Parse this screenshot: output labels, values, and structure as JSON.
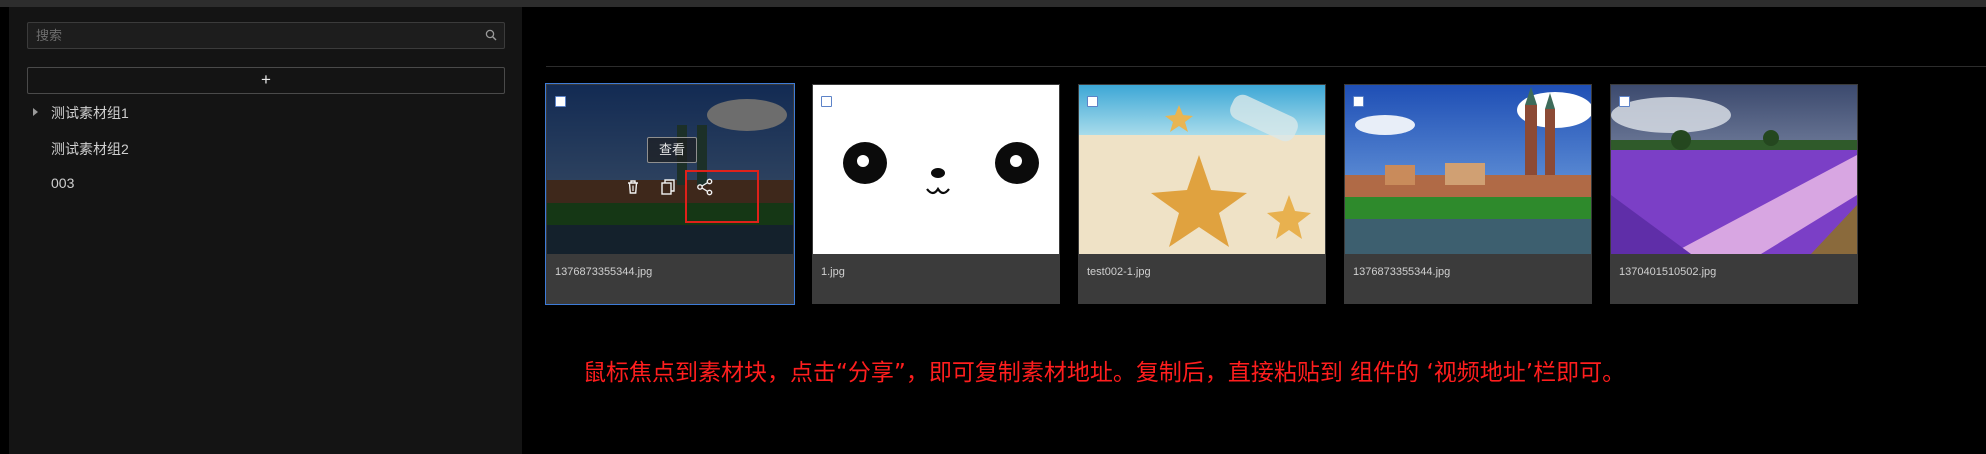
{
  "search": {
    "placeholder": "搜索",
    "icon": "search-icon"
  },
  "add_button": {
    "label": "+"
  },
  "groups": [
    {
      "label": "测试素材组1",
      "expandable": true
    },
    {
      "label": "测试素材组2"
    },
    {
      "label": "003"
    }
  ],
  "cards": [
    {
      "filename": "1376873355344.jpg",
      "checked": false,
      "hovered": true
    },
    {
      "filename": "1.jpg",
      "checked": false
    },
    {
      "filename": "test002-1.jpg",
      "checked": false
    },
    {
      "filename": "1376873355344.jpg",
      "checked": false
    },
    {
      "filename": "1370401510502.jpg",
      "checked": false
    }
  ],
  "hover_actions": {
    "view_label": "查看",
    "icons": [
      "trash-icon",
      "copy-icon",
      "share-icon"
    ]
  },
  "instruction": "鼠标焦点到素材块，点击“分享”，即可复制素材地址。复制后，直接粘贴到  组件的 ‘视频地址’栏即可。",
  "colors": {
    "accent": "#3d7bd7",
    "highlight": "#e0211a",
    "note": "#ff1e1e"
  }
}
